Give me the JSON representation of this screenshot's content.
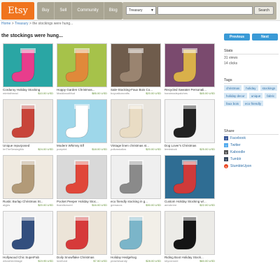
{
  "header": {
    "logo": "Etsy",
    "nav": [
      "Buy",
      "Sell",
      "Community",
      "Blog"
    ],
    "search_scope": "Treasury",
    "search_button": "Search"
  },
  "breadcrumb": {
    "home": "Home",
    "sep1": ">",
    "treasury": "Treasury",
    "sep2": ">",
    "current": "the stockings were hung..."
  },
  "page_title": "the stockings were hung...",
  "pager": {
    "prev": "Previous",
    "next": "Next"
  },
  "stats": {
    "heading": "Stats",
    "views": "31 views",
    "clicks": "14 clicks"
  },
  "tags": {
    "heading": "Tags",
    "items": [
      "christmas",
      "holiday",
      "stockings",
      "holiday decor",
      "unique",
      "fabric",
      "faux bois",
      "eco friendly"
    ]
  },
  "share": {
    "heading": "Share",
    "items": [
      {
        "label": "Facebook",
        "icon": "facebook-icon",
        "color": "#3b5998"
      },
      {
        "label": "Twitter",
        "icon": "twitter-icon",
        "color": "#55acee"
      },
      {
        "label": "Kaboodle",
        "icon": "kaboodle-icon",
        "color": "#555555"
      },
      {
        "label": "Tumblr",
        "icon": "tumblr-icon",
        "color": "#35465c"
      },
      {
        "label": "StumbleUpon",
        "icon": "stumbleupon-icon",
        "color": "#eb4924"
      }
    ]
  },
  "items": [
    {
      "title": "Corduroy Holiday Stocking",
      "shop": "mimisthread",
      "price": "$10.00 USD",
      "bg": "#2aa6a4",
      "stocking": "#e83d8c"
    },
    {
      "title": "Hoppy Garden Christmas...",
      "shop": "MadAboutMud",
      "price": "$85.00 USD",
      "bg": "#a6c24a",
      "stocking": "#e0893a"
    },
    {
      "title": "Sale-Stocking-Faux Bois Co...",
      "shop": "boyvalkorcrafts",
      "price": "$20.00 USD",
      "bg": "#6f5c4c",
      "stocking": "#9a8470"
    },
    {
      "title": "Recycled Sweater Personali...",
      "shop": "handmadepatches",
      "price": "$45.00 USD",
      "bg": "#7a4a6e",
      "stocking": "#d9b04a"
    },
    {
      "title": "Unique repurposed",
      "shop": "ImTheSewingMo",
      "price": "$24.00 USD",
      "bg": "#ece8e2",
      "stocking": "#c8453a"
    },
    {
      "title": "Modern Whimsy Elf",
      "shop": "poeprint",
      "price": "$18.00 USD",
      "bg": "#9ed7ea",
      "stocking": "#ffffff"
    },
    {
      "title": "Vintage linen christmas st...",
      "shop": "polkastudios",
      "price": "$20.00 USD",
      "bg": "#e8e4dd",
      "stocking": "#e9dcc4"
    },
    {
      "title": "Dog Lover's Christmas",
      "shop": "lemitstock",
      "price": "$25.00 USD",
      "bg": "#f3f3f3",
      "stocking": "#222222"
    },
    {
      "title": "Rustic Burlap Christmas St...",
      "shop": "alyjes",
      "price": "$20.00 USD",
      "bg": "#efe9df",
      "stocking": "#b29a78"
    },
    {
      "title": "Pocket Peeper Holiday Stoc...",
      "shop": "thamilsmorel",
      "price": "$16.00 USD",
      "bg": "#d9d9d9",
      "stocking": "#e0473a"
    },
    {
      "title": "eco friendly stocking in g...",
      "shop": "grenacos",
      "price": "$30.00 USD",
      "bg": "#efefef",
      "stocking": "#8a8a8a"
    },
    {
      "title": "Custom Holiday Stocking w/...",
      "shop": "aerobrere",
      "price": "$22.00 USD",
      "bg": "#2f6d93",
      "stocking": "#cf3a3a"
    },
    {
      "title": "Hollywood Chic SuperFab",
      "shop": "whosthevintage",
      "price": "$19.95 USD",
      "bg": "#f4f4f4",
      "stocking": "#334f7e"
    },
    {
      "title": "Doily Snowflake Christmas",
      "shop": "lovefund",
      "price": "$7.50 USD",
      "bg": "#ece4d8",
      "stocking": "#d63a3a"
    },
    {
      "title": "Holiday Hedgehog",
      "shop": "peachesandy",
      "price": "$28.00 USD",
      "bg": "#f2efe8",
      "stocking": "#7bb5c9"
    },
    {
      "title": "Riding Boot Holiday Stock...",
      "shop": "shyoxmore",
      "price": "$60.00 USD",
      "bg": "#ecebe7",
      "stocking": "#151515"
    }
  ]
}
